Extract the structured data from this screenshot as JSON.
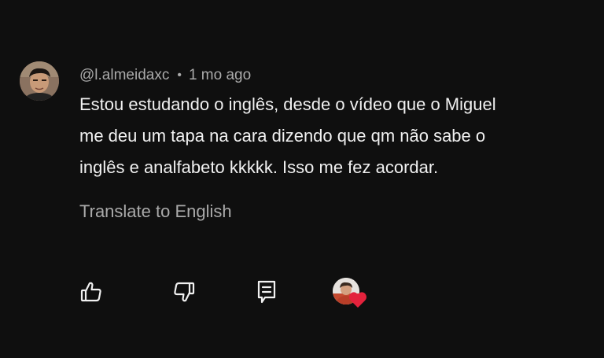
{
  "comment": {
    "author": "@l.almeidaxc",
    "separator": "•",
    "time": "1 mo ago",
    "text_lines": [
      "Estou estudando o inglês, desde o vídeo que o Miguel",
      "me deu um tapa na cara dizendo que qm não sabe o",
      "inglês e analfabeto kkkkk. Isso me fez acordar."
    ],
    "translate_label": "Translate to English"
  },
  "actions": {
    "icons": [
      "thumbs-up-icon",
      "thumbs-down-icon",
      "reply-icon",
      "creator-heart-icon"
    ]
  },
  "colors": {
    "background": "#0f0f0f",
    "primary_text": "#f1f1f1",
    "secondary_text": "#aaaaaa",
    "heart": "#e3223c"
  }
}
